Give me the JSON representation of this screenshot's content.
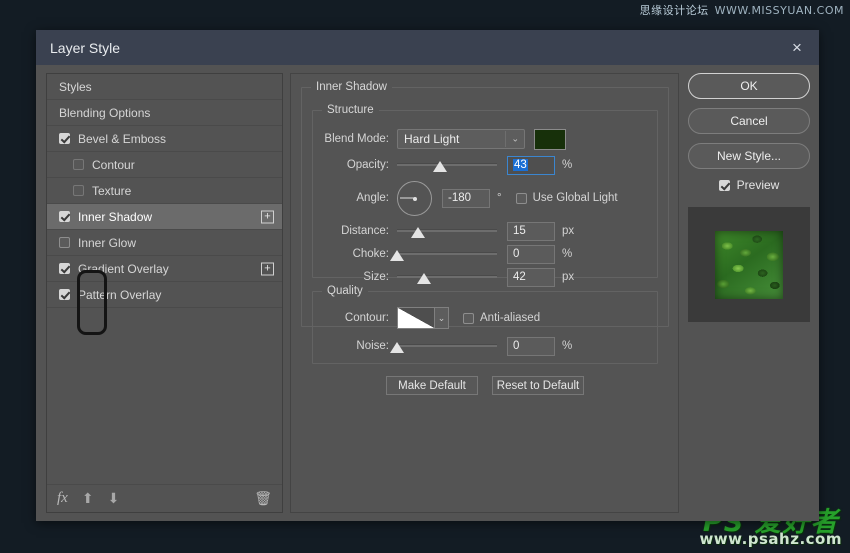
{
  "watermarks": {
    "top_cn": "思缘设计论坛",
    "top_url": "WWW.MISSYUAN.COM",
    "bottom_brand": "PS 爱好者",
    "bottom_url": "www.psahz.com"
  },
  "dialog": {
    "title": "Layer Style",
    "close_icon": "×"
  },
  "sidebar": {
    "items": [
      {
        "label": "Styles",
        "type": "plain",
        "checked": null,
        "indent": false,
        "selected": false,
        "plus": false
      },
      {
        "label": "Blending Options",
        "type": "plain",
        "checked": null,
        "indent": false,
        "selected": false,
        "plus": false
      },
      {
        "label": "Bevel & Emboss",
        "type": "checkbox",
        "checked": true,
        "indent": false,
        "selected": false,
        "plus": false
      },
      {
        "label": "Contour",
        "type": "checkbox",
        "checked": false,
        "indent": true,
        "selected": false,
        "plus": false
      },
      {
        "label": "Texture",
        "type": "checkbox",
        "checked": false,
        "indent": true,
        "selected": false,
        "plus": false
      },
      {
        "label": "Inner Shadow",
        "type": "checkbox",
        "checked": true,
        "indent": false,
        "selected": true,
        "plus": true
      },
      {
        "label": "Inner Glow",
        "type": "checkbox",
        "checked": false,
        "indent": false,
        "selected": false,
        "plus": false
      },
      {
        "label": "Gradient Overlay",
        "type": "checkbox",
        "checked": true,
        "indent": false,
        "selected": false,
        "plus": true
      },
      {
        "label": "Pattern Overlay",
        "type": "checkbox",
        "checked": true,
        "indent": false,
        "selected": false,
        "plus": false
      }
    ],
    "footer": {
      "fx_icon": "fx",
      "up_icon": "⬆",
      "down_icon": "⬇",
      "trash_icon": "🗑"
    },
    "plus_label": "+"
  },
  "main": {
    "section_title": "Inner Shadow",
    "structure": {
      "legend": "Structure",
      "blend_mode_label": "Blend Mode:",
      "blend_mode_value": "Hard Light",
      "blend_mode_caret": "⌄",
      "shadow_color": "#17300a",
      "opacity_label": "Opacity:",
      "opacity_value": "43",
      "opacity_unit": "%",
      "opacity_percent": 43,
      "angle_label": "Angle:",
      "angle_value": "-180",
      "angle_unit": "°",
      "use_global_light_label": "Use Global Light",
      "use_global_light_checked": false,
      "distance_label": "Distance:",
      "distance_value": "15",
      "distance_unit": "px",
      "distance_percent": 21,
      "choke_label": "Choke:",
      "choke_value": "0",
      "choke_unit": "%",
      "choke_percent": 0,
      "size_label": "Size:",
      "size_value": "42",
      "size_unit": "px",
      "size_percent": 27
    },
    "quality": {
      "legend": "Quality",
      "contour_label": "Contour:",
      "contour_caret": "⌄",
      "anti_aliased_label": "Anti-aliased",
      "anti_aliased_checked": false,
      "noise_label": "Noise:",
      "noise_value": "0",
      "noise_unit": "%",
      "noise_percent": 0
    },
    "make_default_label": "Make Default",
    "reset_default_label": "Reset to Default"
  },
  "right": {
    "ok_label": "OK",
    "cancel_label": "Cancel",
    "new_style_label": "New Style...",
    "preview_label": "Preview",
    "preview_checked": true
  }
}
